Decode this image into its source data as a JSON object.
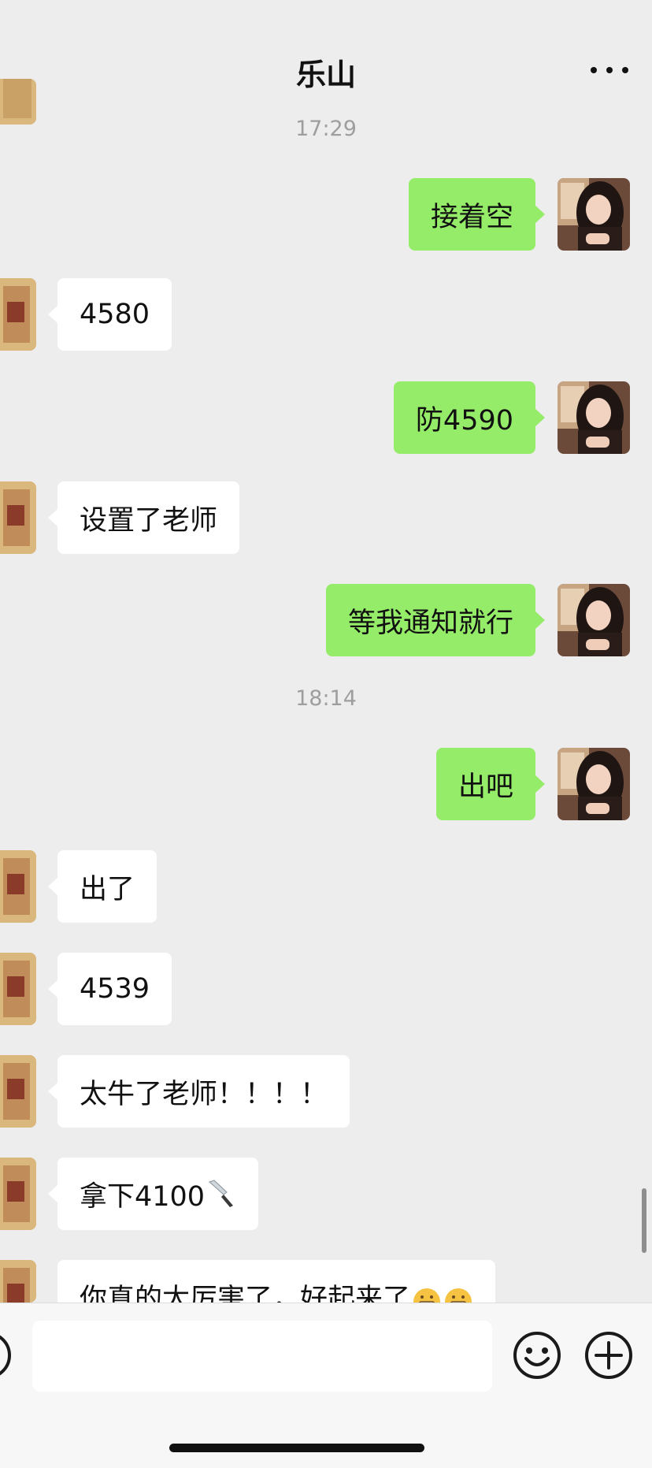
{
  "header": {
    "title": "乐山",
    "more_icon": "more-dots-icon"
  },
  "timestamps": [
    "17:29",
    "18:14"
  ],
  "messages": [
    {
      "side": "self",
      "text": "接着空"
    },
    {
      "side": "other",
      "text": "4580"
    },
    {
      "side": "self",
      "text": "防4590"
    },
    {
      "side": "other",
      "text": "设置了老师"
    },
    {
      "side": "self",
      "text": "等我通知就行"
    },
    {
      "side": "self",
      "text": "出吧"
    },
    {
      "side": "other",
      "text": "出了"
    },
    {
      "side": "other",
      "text": "4539"
    },
    {
      "side": "other",
      "text": "太牛了老师！！！！"
    },
    {
      "side": "other",
      "text": "拿下4100",
      "emoji": "kitchen-knife"
    },
    {
      "side": "other",
      "text": "你真的太厉害了，好起来了",
      "emoji": "grinning-face-x2"
    }
  ],
  "input_bar": {
    "input_value": "",
    "voice_icon": "voice-icon",
    "emoji_icon": "smiley-icon",
    "plus_icon": "plus-icon"
  },
  "colors": {
    "background": "#ededed",
    "self_bubble": "#95ec69",
    "other_bubble": "#ffffff",
    "timestamp": "#9e9e9e"
  }
}
